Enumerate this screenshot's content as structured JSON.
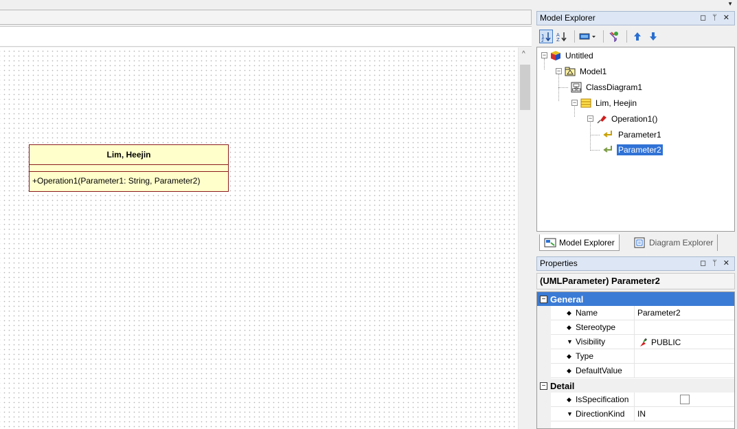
{
  "model_explorer": {
    "title": "Model Explorer",
    "window_buttons": "◻ ᛘ ✕",
    "tree": [
      {
        "label": "Untitled",
        "icon": "project-cube-icon"
      },
      {
        "label": "Model1",
        "icon": "model-package-icon"
      },
      {
        "label": "ClassDiagram1",
        "icon": "class-diagram-icon"
      },
      {
        "label": "Lim, Heejin",
        "icon": "class-icon"
      },
      {
        "label": "Operation1()",
        "icon": "operation-icon"
      },
      {
        "label": "Parameter1",
        "icon": "parameter-icon"
      },
      {
        "label": "Parameter2",
        "icon": "parameter-icon",
        "selected": true
      }
    ],
    "tabs": {
      "model": "Model Explorer",
      "diagram": "Diagram Explorer"
    }
  },
  "diagram": {
    "class_name": "Lim, Heejin",
    "operation": "+Operation1(Parameter1: String, Parameter2)"
  },
  "properties": {
    "title": "Properties",
    "window_buttons": "◻ ᛘ ✕",
    "header": "(UMLParameter) Parameter2",
    "general_label": "General",
    "detail_label": "Detail",
    "general": [
      {
        "name": "Name",
        "value": "Parameter2",
        "marker": "◆"
      },
      {
        "name": "Stereotype",
        "value": "",
        "marker": "◆"
      },
      {
        "name": "Visibility",
        "value": "PUBLIC",
        "marker": "▼"
      },
      {
        "name": "Type",
        "value": "",
        "marker": "◆"
      },
      {
        "name": "DefaultValue",
        "value": "",
        "marker": "◆"
      }
    ],
    "detail": [
      {
        "name": "IsSpecification",
        "value": "",
        "marker": "◆"
      },
      {
        "name": "DirectionKind",
        "value": "IN",
        "marker": "▼"
      }
    ]
  },
  "colors": {
    "selection": "#3072d6",
    "class_fill": "#ffffcc",
    "class_border": "#8b1a1a"
  }
}
